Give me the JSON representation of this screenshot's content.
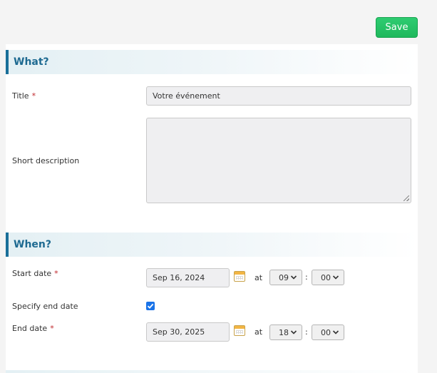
{
  "toolbar": {
    "save_label": "Save"
  },
  "sections": {
    "what": {
      "title": "What?"
    },
    "when": {
      "title": "When?"
    }
  },
  "fields": {
    "title": {
      "label": "Title",
      "required_mark": "*",
      "value": "Votre événement"
    },
    "short_description": {
      "label": "Short description",
      "value": ""
    },
    "start_date": {
      "label": "Start date",
      "required_mark": "*",
      "date": "Sep 16, 2024",
      "at_label": "at",
      "hour": "09",
      "minute": "00"
    },
    "specify_end_date": {
      "label": "Specify end date",
      "checked": true
    },
    "end_date": {
      "label": "End date",
      "required_mark": "*",
      "date": "Sep 30, 2025",
      "at_label": "at",
      "hour": "18",
      "minute": "00"
    }
  },
  "time_separator": ":",
  "icons": {
    "calendar": "calendar-icon",
    "chevron": "chevron-down-icon",
    "check": "check-icon"
  },
  "colors": {
    "accent": "#1e6a91",
    "save_button": "#2ecc71",
    "required": "#c0282d",
    "checkbox": "#1a73e8"
  }
}
